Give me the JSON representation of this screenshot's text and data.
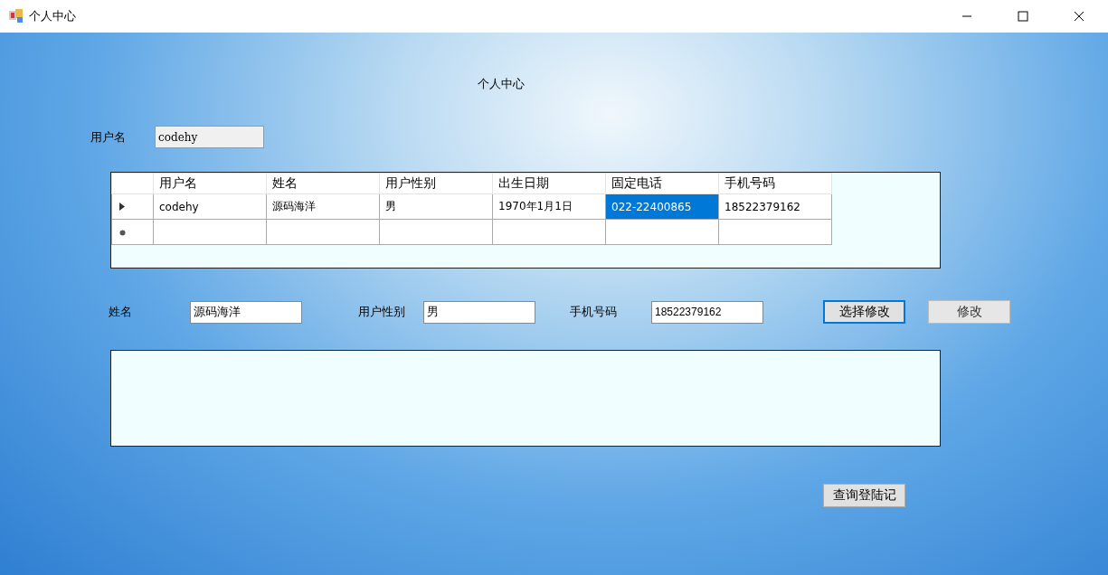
{
  "window": {
    "title": "个人中心"
  },
  "heading": "个人中心",
  "username": {
    "label": "用户名",
    "value": "codehy",
    "readonly": true
  },
  "table": {
    "columns": [
      "用户名",
      "姓名",
      "用户性别",
      "出生日期",
      "固定电话",
      "手机号码"
    ],
    "rows": [
      {
        "kind": "current",
        "cells": [
          {
            "text": "codehy",
            "selected": false
          },
          {
            "text": "源码海洋",
            "selected": false
          },
          {
            "text": "男",
            "selected": false
          },
          {
            "text": "1970年1月1日",
            "selected": false
          },
          {
            "text": "022-22400865",
            "selected": true
          },
          {
            "text": "18522379162",
            "selected": false
          }
        ]
      },
      {
        "kind": "new",
        "cells": [
          {
            "text": "",
            "selected": false
          },
          {
            "text": "",
            "selected": false
          },
          {
            "text": "",
            "selected": false
          },
          {
            "text": "",
            "selected": false
          },
          {
            "text": "",
            "selected": false
          },
          {
            "text": "",
            "selected": false
          }
        ]
      }
    ]
  },
  "form": [
    {
      "label": "姓名",
      "value": "源码海洋"
    },
    {
      "label": "用户性别",
      "value": "男"
    },
    {
      "label": "手机号码",
      "value": "18522379162"
    }
  ],
  "buttons": [
    {
      "label": "选择修改",
      "focused": true,
      "disabled": false
    },
    {
      "label": "修改",
      "focused": false,
      "disabled": true
    }
  ],
  "query_button": {
    "label": "查询登陆记"
  }
}
